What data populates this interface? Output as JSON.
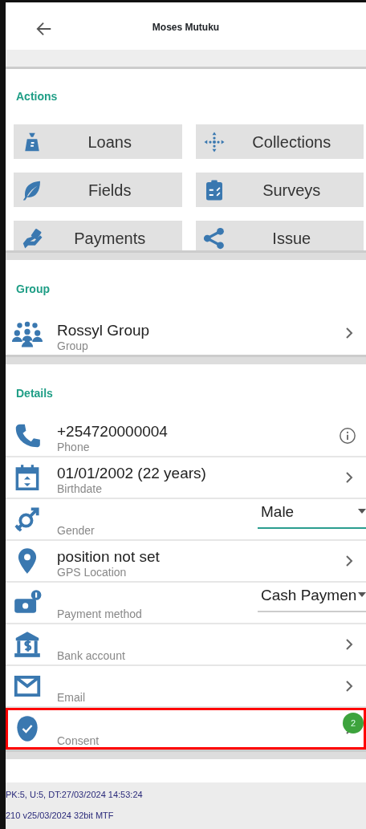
{
  "header": {
    "title": "Moses Mutuku"
  },
  "actions": {
    "title": "Actions",
    "buttons": [
      {
        "label": "Loans"
      },
      {
        "label": "Collections"
      },
      {
        "label": "Fields"
      },
      {
        "label": "Surveys"
      },
      {
        "label": "Payments"
      },
      {
        "label": "Issue"
      }
    ]
  },
  "group": {
    "title": "Group",
    "name": "Rossyl Group",
    "caption": "Group"
  },
  "details": {
    "title": "Details",
    "rows": [
      {
        "kind": "info",
        "value": "+254720000004",
        "label": "Phone",
        "highlighted": false
      },
      {
        "kind": "link",
        "value": "01/01/2002 (22 years)",
        "label": "Birthdate",
        "highlighted": false
      },
      {
        "kind": "dropdown",
        "value": "Male",
        "label": "Gender",
        "focused": true,
        "highlighted": false
      },
      {
        "kind": "link",
        "value": "position not set",
        "label": "GPS Location",
        "highlighted": false
      },
      {
        "kind": "dropdown",
        "value": "Cash Paymen",
        "label": "Payment method",
        "focused": false,
        "highlighted": false
      },
      {
        "kind": "link",
        "label": "Bank account",
        "highlighted": false
      },
      {
        "kind": "link",
        "label": "Email",
        "highlighted": false
      },
      {
        "kind": "link",
        "label": "Consent",
        "highlighted": true,
        "badge": "2"
      }
    ]
  },
  "footer": [
    "PK:5, U:5, DT:27/03/2024 14:53:24",
    "210 v25/03/2024 32bit MTF"
  ]
}
